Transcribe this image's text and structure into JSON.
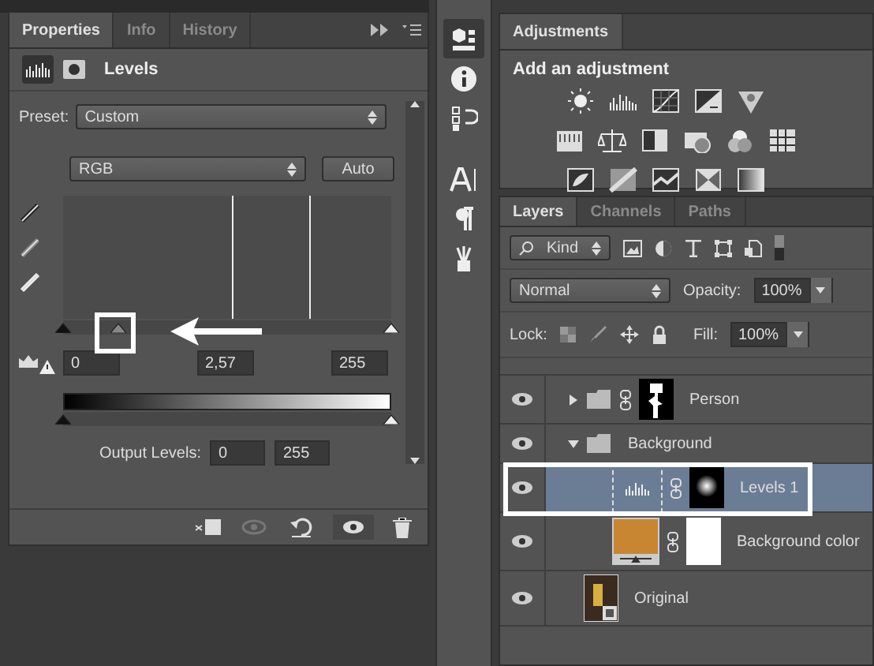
{
  "properties": {
    "tabs": [
      {
        "label": "Properties",
        "selected": true
      },
      {
        "label": "Info",
        "selected": false
      },
      {
        "label": "History",
        "selected": false
      }
    ],
    "title": "Levels",
    "preset": {
      "label": "Preset:",
      "value": "Custom"
    },
    "channel": {
      "value": "RGB"
    },
    "auto_button": "Auto",
    "input_sliders": [
      {
        "level": 0
      },
      {
        "level": 0.17
      },
      {
        "level": 1
      }
    ],
    "input_values": [
      "0",
      "2,57",
      "255"
    ],
    "output_sliders": [
      {
        "level": 0
      },
      {
        "level": 1
      }
    ],
    "output": {
      "label": "Output Levels:",
      "values": [
        "0",
        "255"
      ]
    }
  },
  "adjustments": {
    "tab": "Adjustments",
    "heading": "Add an adjustment"
  },
  "layers": {
    "tabs": [
      {
        "label": "Layers",
        "selected": true
      },
      {
        "label": "Channels",
        "selected": false
      },
      {
        "label": "Paths",
        "selected": false
      }
    ],
    "filter": "Kind",
    "blend_mode": "Normal",
    "opacity": {
      "label": "Opacity:",
      "value": "100%"
    },
    "lock_label": "Lock:",
    "fill": {
      "label": "Fill:",
      "value": "100%"
    },
    "items": [
      {
        "kind": "group",
        "name": "Person",
        "expanded": false,
        "selected": false
      },
      {
        "kind": "group",
        "name": "Background",
        "expanded": true,
        "selected": false,
        "children": [
          {
            "kind": "adjustment",
            "name": "Levels 1",
            "selected": true
          },
          {
            "kind": "fill",
            "name": "Background color",
            "selected": false
          }
        ]
      },
      {
        "kind": "smart",
        "name": "Original",
        "selected": false
      }
    ]
  }
}
